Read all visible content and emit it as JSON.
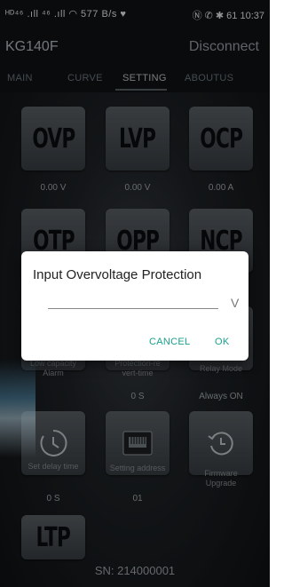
{
  "status_bar": {
    "left": "ᴴᴰ⁴⁶ .ıll ⁴⁶ .ıll ◠ 577 B/s ♥",
    "right": "Ⓝ ✆ ✱ 61 10:37"
  },
  "header": {
    "title": "KG140F",
    "disconnect": "Disconnect"
  },
  "tabs": [
    "MAIN",
    "CURVE",
    "SETTING",
    "ABOUTUS"
  ],
  "tiles": {
    "ovp": {
      "label": "OVP",
      "value": "0.00 V"
    },
    "lvp": {
      "label": "LVP",
      "value": "0.00 V"
    },
    "ocp": {
      "label": "OCP",
      "value": "0.00 A"
    },
    "otp": {
      "label": "OTP"
    },
    "opp": {
      "label": "OPP"
    },
    "ncp": {
      "label": "NCP"
    },
    "low_capacity": {
      "label": "Low capacity Alarm"
    },
    "protection_revert": {
      "label": "Protection-re vert-time",
      "value": "0 S"
    },
    "relay": {
      "label": "Relay Mode",
      "value": "Always ON"
    },
    "set_delay": {
      "label": "Set delay time",
      "value": "0 S"
    },
    "setting_address": {
      "label": "Setting address",
      "value": "01"
    },
    "firmware": {
      "label": "Firmware Upgrade"
    },
    "ltp": {
      "label": "LTP"
    }
  },
  "dialog": {
    "title": "Input Overvoltage Protection",
    "unit": "V",
    "cancel": "CANCEL",
    "ok": "OK"
  },
  "footer": {
    "sn": "SN: 214000001"
  },
  "colors": {
    "accent": "#19a08c",
    "background": "#1f2327",
    "tile": "#4a5055"
  }
}
